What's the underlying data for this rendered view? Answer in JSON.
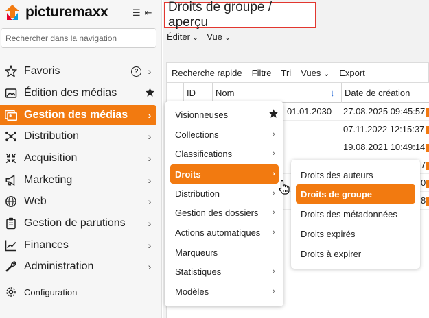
{
  "app": {
    "name": "picturemaxx"
  },
  "sidebar": {
    "search_placeholder": "Rechercher dans la navigation",
    "items": [
      {
        "label": "Favoris",
        "icon": "star-outline-icon",
        "extra": "?"
      },
      {
        "label": "Édition des médias",
        "icon": "image-edit-icon"
      },
      {
        "label": "Gestion des médias",
        "icon": "media-management-icon",
        "active": true
      },
      {
        "label": "Distribution",
        "icon": "distribution-icon"
      },
      {
        "label": "Acquisition",
        "icon": "acquisition-icon"
      },
      {
        "label": "Marketing",
        "icon": "megaphone-icon"
      },
      {
        "label": "Web",
        "icon": "globe-icon"
      },
      {
        "label": "Gestion de parutions",
        "icon": "clipboard-icon"
      },
      {
        "label": "Finances",
        "icon": "chart-line-icon"
      },
      {
        "label": "Administration",
        "icon": "wrench-icon"
      },
      {
        "label": "Configuration",
        "icon": "gear-icon"
      }
    ]
  },
  "main": {
    "title": "Droits de groupe / aperçu",
    "toolbar1": [
      "Éditer",
      "Vue"
    ],
    "toolbar2": [
      "Recherche rapide",
      "Filtre",
      "Tri",
      "Vues",
      "Export"
    ],
    "columns": [
      "ID",
      "Nom",
      "Date de création"
    ],
    "rows": [
      {
        "name_tail": "01.01.2030",
        "date": "27.08.2025 09:45:57"
      },
      {
        "name_tail": "",
        "date": "07.11.2022 12:15:37"
      },
      {
        "name_tail": "",
        "date": "19.08.2021 10:49:14"
      },
      {
        "name_tail": "",
        "date": "7"
      },
      {
        "name_tail": "",
        "date": "0"
      },
      {
        "name_tail": "",
        "date": "8"
      }
    ]
  },
  "submenu1": {
    "items": [
      {
        "label": "Visionneuses",
        "star": true
      },
      {
        "label": "Collections",
        "arrow": true
      },
      {
        "label": "Classifications",
        "arrow": true
      },
      {
        "label": "Droits",
        "arrow": true,
        "active": true
      },
      {
        "label": "Distribution",
        "arrow": true
      },
      {
        "label": "Gestion des dossiers",
        "arrow": true
      },
      {
        "label": "Actions automatiques",
        "arrow": true
      },
      {
        "label": "Marqueurs"
      },
      {
        "label": "Statistiques",
        "arrow": true
      },
      {
        "label": "Modèles",
        "arrow": true
      }
    ]
  },
  "submenu2": {
    "items": [
      {
        "label": "Droits des auteurs"
      },
      {
        "label": "Droits de groupe",
        "active": true
      },
      {
        "label": "Droits des métadonnées"
      },
      {
        "label": "Droits expirés"
      },
      {
        "label": "Droits à expirer"
      }
    ]
  },
  "colors": {
    "accent": "#f27a10",
    "highlight_border": "#e2372f",
    "sort_arrow": "#2f6fd6"
  }
}
